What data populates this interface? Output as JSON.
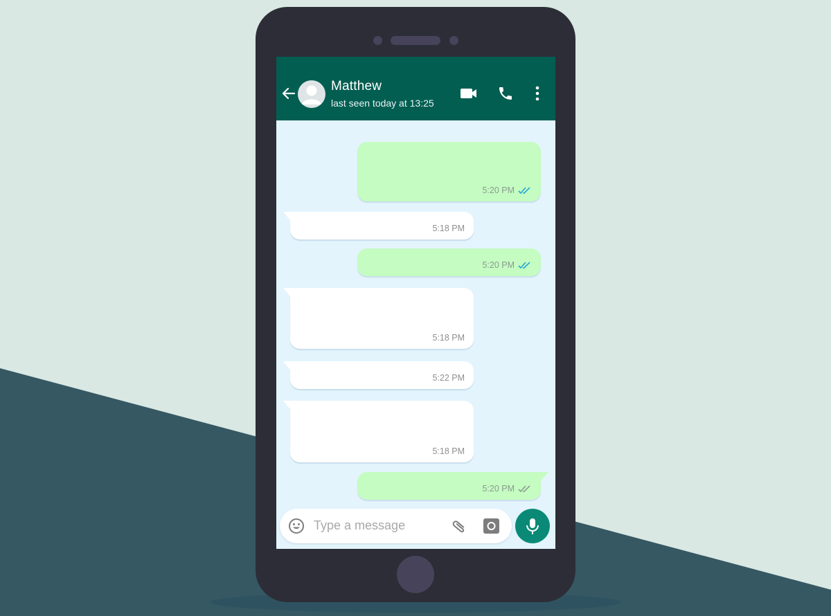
{
  "header": {
    "contact_name": "Matthew",
    "status": "last seen today at 13:25",
    "icons": [
      "back-arrow-icon",
      "avatar",
      "video-call-icon",
      "voice-call-icon",
      "more-options-icon"
    ]
  },
  "messages": [
    {
      "direction": "outgoing",
      "time": "5:20 PM",
      "ticks": "read"
    },
    {
      "direction": "incoming",
      "time": "5:18 PM"
    },
    {
      "direction": "outgoing",
      "time": "5:20 PM",
      "ticks": "read"
    },
    {
      "direction": "incoming",
      "time": "5:18 PM"
    },
    {
      "direction": "incoming",
      "time": "5:22 PM"
    },
    {
      "direction": "incoming",
      "time": "5:18 PM"
    },
    {
      "direction": "outgoing",
      "time": "5:20 PM",
      "ticks": "delivered"
    }
  ],
  "composer": {
    "placeholder": "Type a message",
    "icons": [
      "emoji-icon",
      "attach-icon",
      "camera-icon",
      "mic-icon"
    ]
  },
  "colors": {
    "header": "#035e52",
    "chat_background": "#e3f4fd",
    "outgoing_bubble": "#c5fcc1",
    "incoming_bubble": "#ffffff",
    "read_ticks": "#1ea5d8",
    "delivered_ticks": "#8a9a92",
    "mic_button": "#0a8a76",
    "phone_body": "#2d2d37"
  }
}
